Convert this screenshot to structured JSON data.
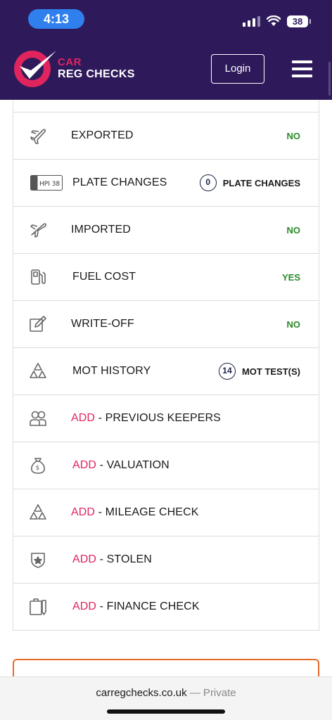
{
  "status_bar": {
    "time": "4:13",
    "battery": "38"
  },
  "header": {
    "logo_line1": "CAR",
    "logo_line2": "REG CHECKS",
    "login_label": "Login",
    "colors": {
      "background": "#2e1a5a",
      "accent": "#e0245e"
    }
  },
  "rows": [
    {
      "icon": "plane-departure-icon",
      "label": "EXPORTED",
      "value": "NO"
    },
    {
      "icon": "number-plate-icon",
      "plate_text": "HPI 38",
      "label": "PLATE CHANGES",
      "count": "0",
      "count_label": "PLATE CHANGES"
    },
    {
      "icon": "plane-arrival-icon",
      "label": "IMPORTED",
      "value": "NO"
    },
    {
      "icon": "fuel-pump-icon",
      "label": "FUEL COST",
      "value": "YES"
    },
    {
      "icon": "edit-document-icon",
      "label": "WRITE-OFF",
      "value": "NO"
    },
    {
      "icon": "warning-triangles-icon",
      "label": "MOT HISTORY",
      "count": "14",
      "count_label": "MOT TEST(S)"
    },
    {
      "icon": "people-icon",
      "add": "ADD",
      "label": "- PREVIOUS KEEPERS"
    },
    {
      "icon": "money-bag-icon",
      "add": "ADD",
      "label": "- VALUATION"
    },
    {
      "icon": "warning-triangles-icon",
      "add": "ADD",
      "label": "- MILEAGE CHECK"
    },
    {
      "icon": "police-badge-icon",
      "add": "ADD",
      "label": "- STOLEN"
    },
    {
      "icon": "finance-document-icon",
      "add": "ADD",
      "label": "- FINANCE CHECK"
    }
  ],
  "browser": {
    "domain": "carregchecks.co.uk",
    "mode": "— Private"
  }
}
